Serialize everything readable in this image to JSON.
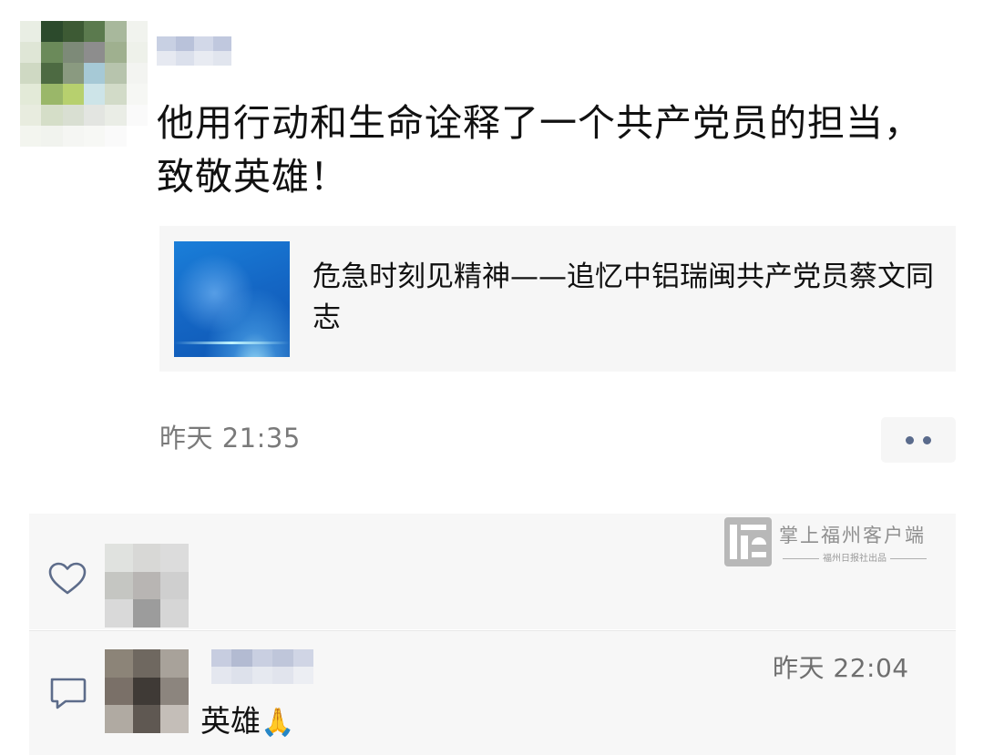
{
  "post": {
    "text": "他用行动和生命诠释了一个共产党员的担当，致敬英雄！",
    "link_card": {
      "title": "危急时刻见精神——追忆中铝瑞闽共产党员蔡文同志"
    },
    "time": "昨天 21:35"
  },
  "watermark": {
    "name": "掌上福州客户端",
    "sub": "福州日报社出品"
  },
  "comment": {
    "time": "昨天 22:04",
    "text": "英雄",
    "emoji": "🙏"
  },
  "icons": {
    "more": "more-dots-icon",
    "like": "heart-icon",
    "comment": "comment-bubble-icon"
  },
  "colors": {
    "timestamp": "#7a7a7a",
    "panel": "#f7f7f7",
    "more_dots": "#5a6b8c"
  }
}
